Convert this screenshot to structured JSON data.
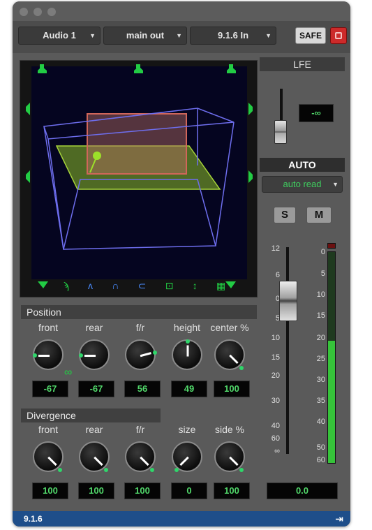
{
  "header": {
    "track": "Audio 1",
    "output": "main out",
    "format": "9.1.6 In",
    "safe_label": "SAFE"
  },
  "position": {
    "title": "Position",
    "knobs": [
      {
        "label": "front",
        "value": "-67"
      },
      {
        "label": "rear",
        "value": "-67"
      },
      {
        "label": "f/r",
        "value": "56"
      },
      {
        "label": "height",
        "value": "49"
      },
      {
        "label": "center %",
        "value": "100"
      }
    ]
  },
  "divergence": {
    "title": "Divergence",
    "knobs": [
      {
        "label": "front",
        "value": "100"
      },
      {
        "label": "rear",
        "value": "100"
      },
      {
        "label": "f/r",
        "value": "100"
      },
      {
        "label": "size",
        "value": "0"
      },
      {
        "label": "side %",
        "value": "100"
      }
    ]
  },
  "lfe": {
    "title": "LFE",
    "value": "-∞"
  },
  "automation": {
    "title": "AUTO",
    "mode": "auto read"
  },
  "solo_label": "S",
  "mute_label": "M",
  "fader_scale": [
    "12",
    "6",
    "0",
    "5",
    "10",
    "15",
    "20",
    "30",
    "40",
    "60",
    "∞"
  ],
  "meter_scale": [
    "0",
    "5",
    "10",
    "15",
    "20",
    "25",
    "30",
    "35",
    "40",
    "50",
    "60"
  ],
  "meter_level": 0.58,
  "output_value": "0.0",
  "status": {
    "format": "9.1.6"
  },
  "colors": {
    "accent_green": "#51d86a",
    "safe_red": "#cc2a2a",
    "status_blue": "#1e4e8a"
  }
}
